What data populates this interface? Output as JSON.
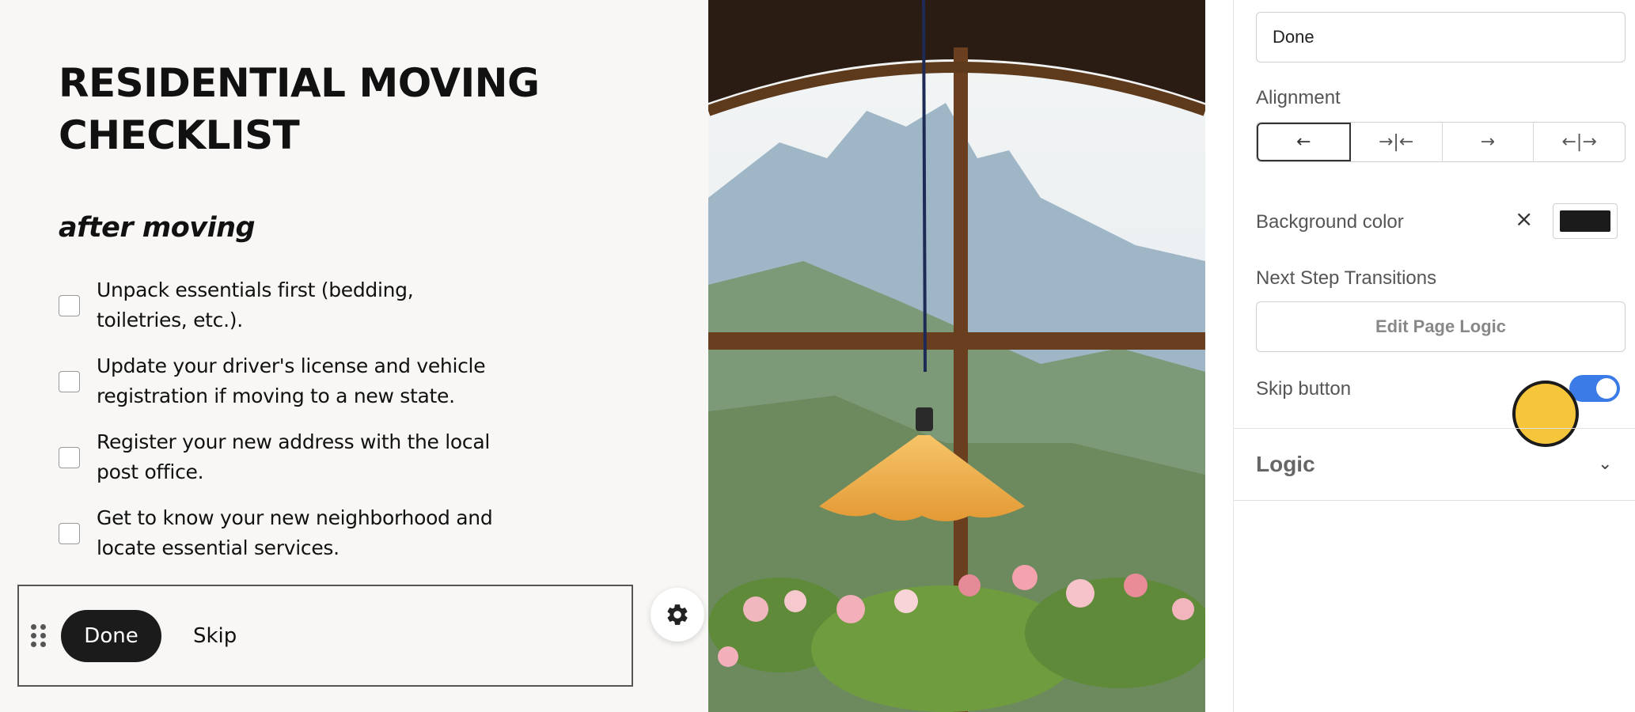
{
  "page": {
    "title": "RESIDENTIAL MOVING CHECKLIST",
    "section": "after moving",
    "checklist": [
      "Unpack essentials first (bedding, toiletries, etc.).",
      "Update your driver's license and vehicle registration if moving to a new state.",
      "Register your new address with the local post office.",
      "Get to know your new neighborhood and locate essential services."
    ],
    "buttons": {
      "done_label": "Done",
      "skip_label": "Skip"
    }
  },
  "panel": {
    "button_text_value": "Done",
    "alignment_label": "Alignment",
    "alignment_options": [
      "←",
      "→|←",
      "→",
      "←|→"
    ],
    "alignment_selected": "left",
    "background_color_label": "Background color",
    "clear_icon": "×",
    "background_color": "#1b1b1b",
    "next_step_label": "Next Step Transitions",
    "edit_logic_label": "Edit Page Logic",
    "skip_button_label": "Skip button",
    "skip_button_enabled": true,
    "logic_section_title": "Logic",
    "chevron_icon": "⌄"
  },
  "icons": {
    "gear": "gear-icon",
    "drag": "drag-handle-icon"
  },
  "colors": {
    "accent": "#3b7be8",
    "marker": "#f7c53a",
    "button_dark": "#1b1b1b"
  }
}
